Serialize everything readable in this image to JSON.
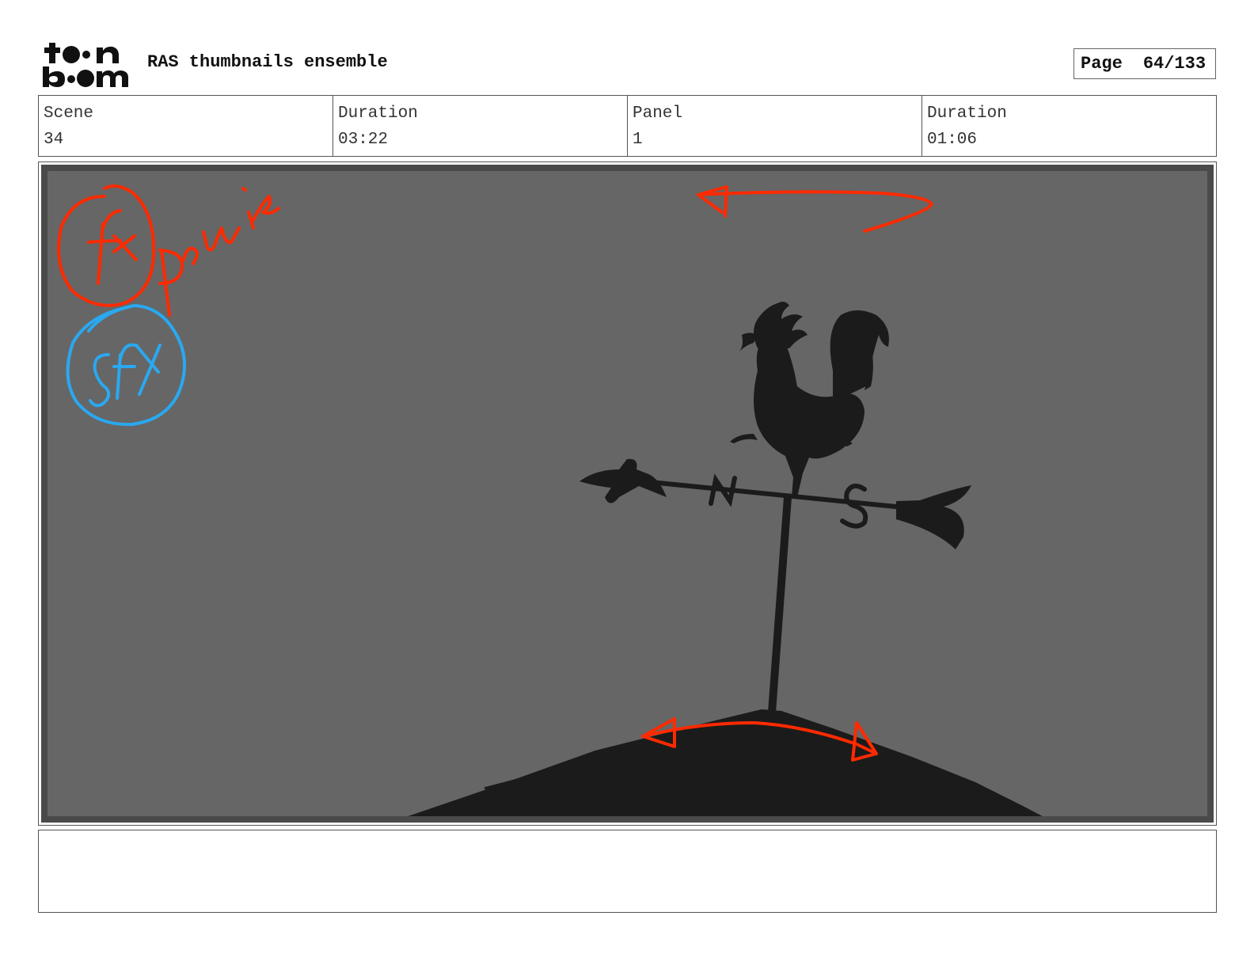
{
  "header": {
    "logo_text_top": "toon",
    "logo_text_bottom": "boom",
    "project_title": "RAS thumbnails ensemble",
    "page_label": "Page",
    "page_value": "64/133"
  },
  "info": {
    "scene_label": "Scene",
    "scene_value": "34",
    "scene_duration_label": "Duration",
    "scene_duration_value": "03:22",
    "panel_label": "Panel",
    "panel_value": "1",
    "panel_duration_label": "Duration",
    "panel_duration_value": "01:06"
  },
  "panel_image": {
    "background_color": "#666666",
    "annotation_red": "#ff2a00",
    "annotation_blue": "#2aa8f0",
    "silhouette_color": "#1b1b1b",
    "handwritten_notes": [
      "Fx",
      "Pluie",
      "SFX"
    ],
    "vane_letters": [
      "N",
      "S"
    ]
  },
  "notes": {
    "text": ""
  }
}
